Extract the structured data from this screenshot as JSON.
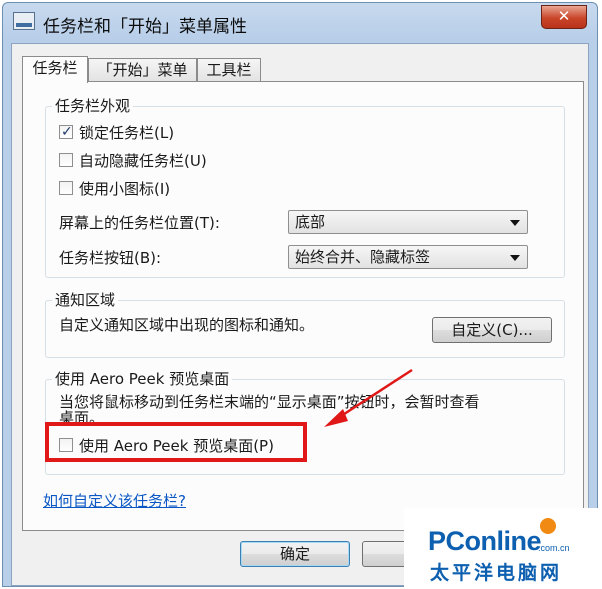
{
  "window": {
    "title": "任务栏和「开始」菜单属性",
    "close_label": "✕"
  },
  "tabs": [
    {
      "label": "任务栏",
      "active": true
    },
    {
      "label": "「开始」菜单",
      "active": false
    },
    {
      "label": "工具栏",
      "active": false
    }
  ],
  "appearance": {
    "group_label": "任务栏外观",
    "options": [
      {
        "label": "锁定任务栏(L)",
        "checked": true
      },
      {
        "label": "自动隐藏任务栏(U)",
        "checked": false
      },
      {
        "label": "使用小图标(I)",
        "checked": false
      }
    ],
    "position_label": "屏幕上的任务栏位置(T):",
    "position_value": "底部",
    "buttons_label": "任务栏按钮(B):",
    "buttons_value": "始终合并、隐藏标签"
  },
  "notification": {
    "group_label": "通知区域",
    "description": "自定义通知区域中出现的图标和通知。",
    "customize_button": "自定义(C)..."
  },
  "aero_peek": {
    "group_label": "使用 Aero Peek 预览桌面",
    "description_line1": "当您将鼠标移动到任务栏末端的“显示桌面”按钮时，会暂时查看",
    "description_line2": "桌面。",
    "checkbox_label": "使用 Aero Peek 预览桌面(P)",
    "checked": false
  },
  "help_link": "如何自定义该任务栏?",
  "footer": {
    "ok_button": "确定",
    "cancel_button_partial": "取"
  },
  "watermark": {
    "brand": "PConline",
    "domain": ".com.cn",
    "sub": "太平洋电脑网"
  },
  "colors": {
    "highlight": "#e01818",
    "link": "#0a57c4",
    "brand": "#0d5fb0",
    "brand_dot": "#f08a12"
  }
}
